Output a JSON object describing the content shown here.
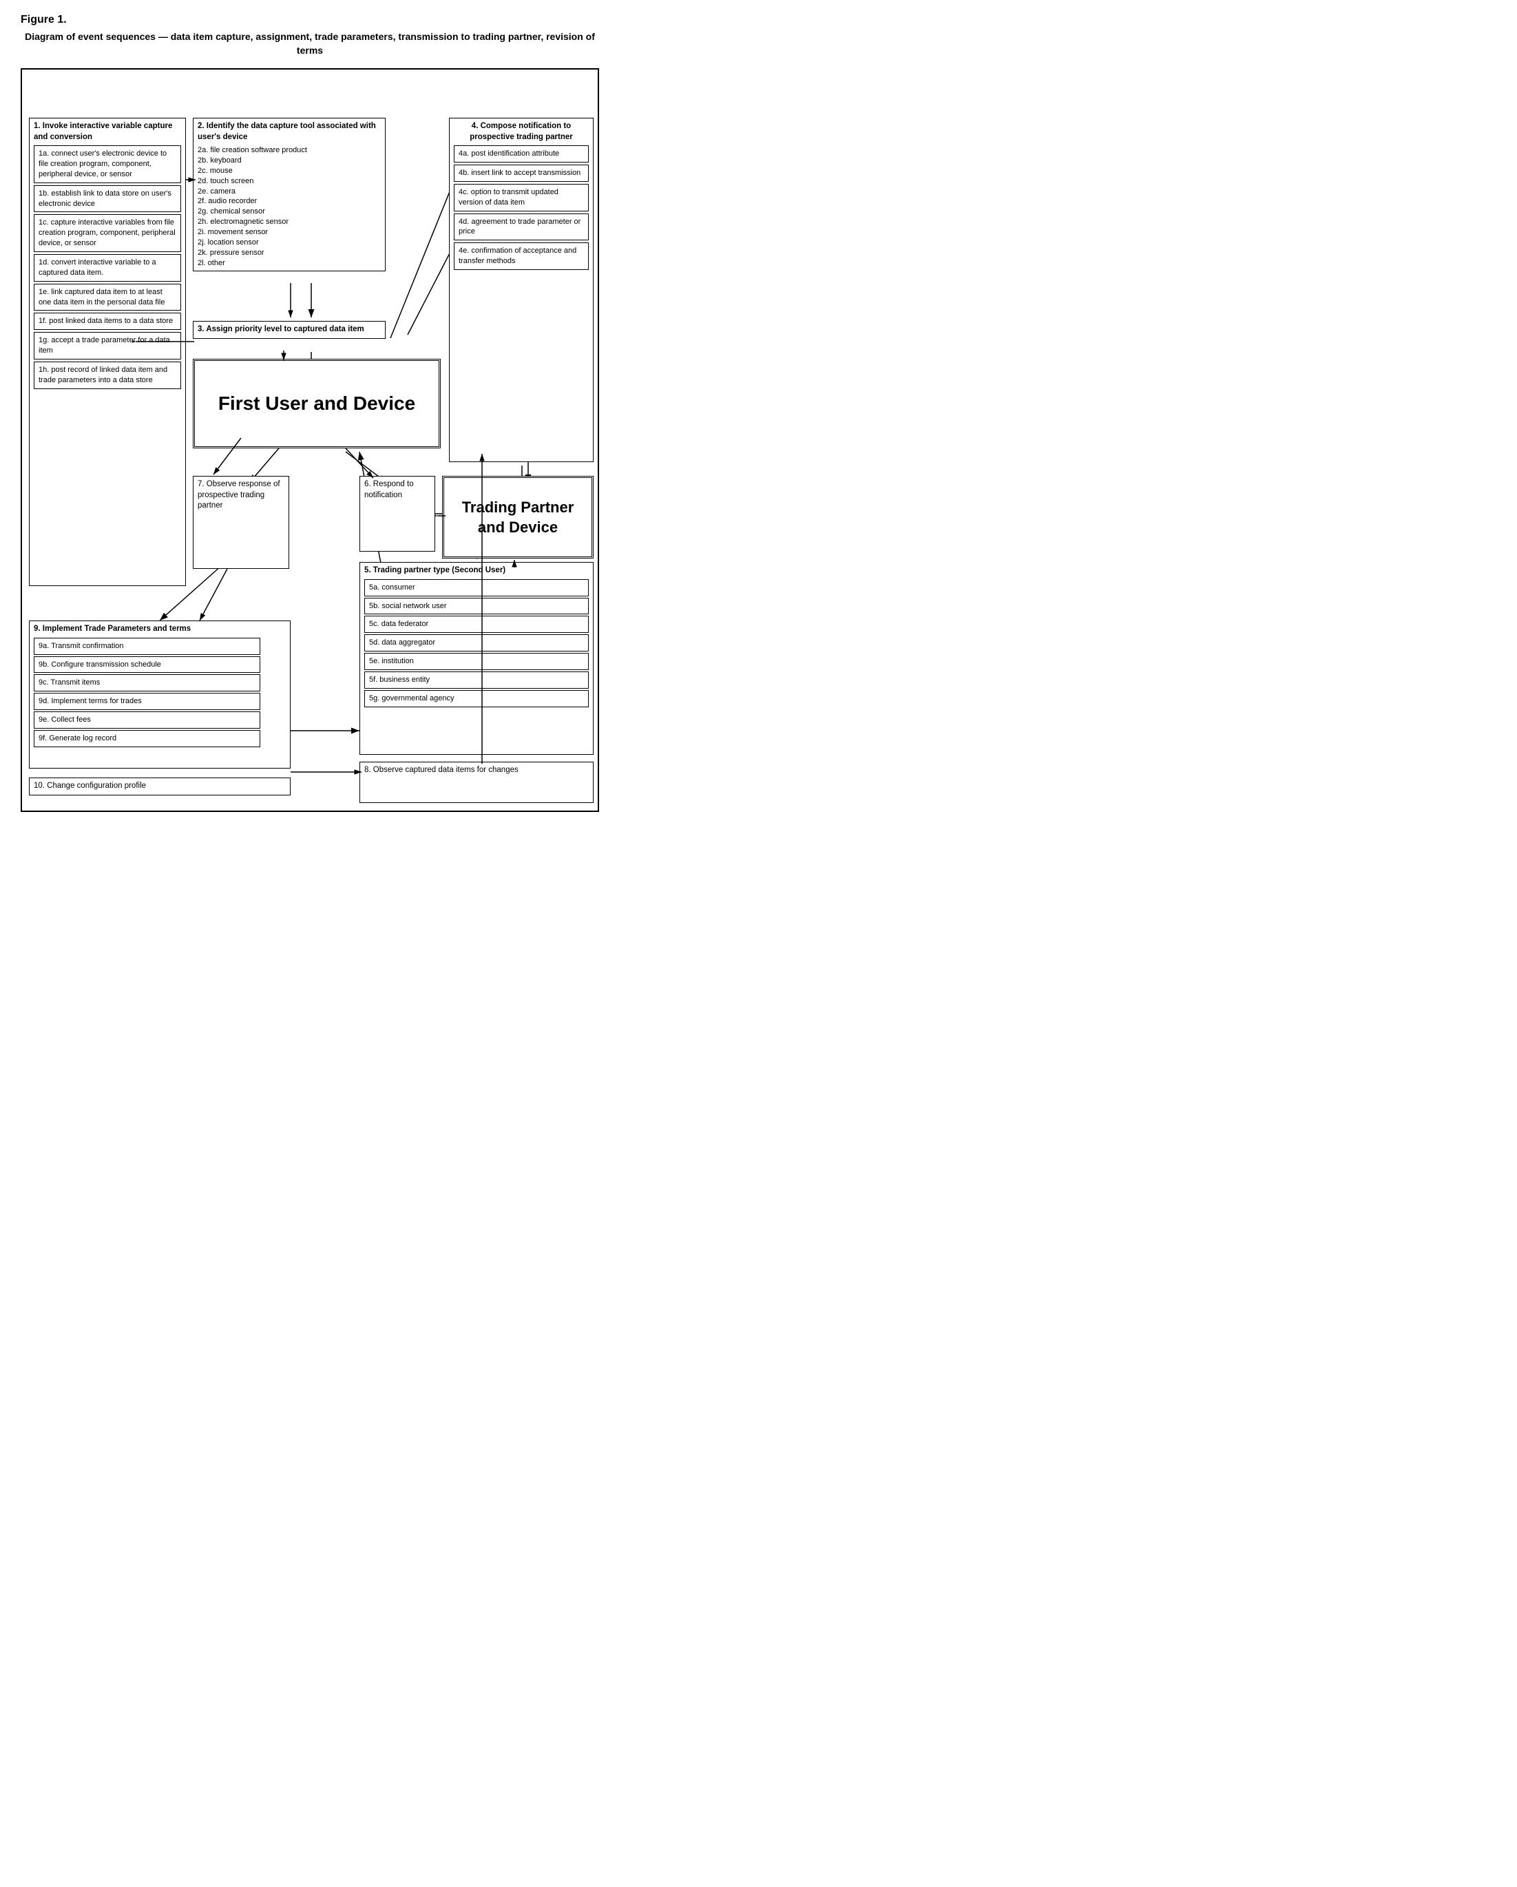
{
  "figure_label": "Figure 1.",
  "diagram_title": "Diagram of event sequences — data item capture, assignment, trade parameters, transmission to trading partner, revision of terms",
  "boxes": {
    "box1_title": "1. Invoke interactive variable capture and conversion",
    "box1a": "1a. connect user's electronic device to file creation program, component, peripheral device, or sensor",
    "box1b": "1b. establish link to data store on user's electronic device",
    "box1c": "1c. capture interactive variables from file creation program, component, peripheral device, or sensor",
    "box1d": "1d. convert interactive variable to a captured data item.",
    "box1e": "1e. link captured data item to at least one data item in the personal data file",
    "box1f": "1f. post linked data items to a data store",
    "box1g": "1g. accept a trade parameter for a data item",
    "box1h": "1h. post record of linked data item and trade parameters into a data store",
    "box2_title": "2. Identify the data capture tool associated with user's device",
    "box2_items": "2a. file creation software product\n2b. keyboard\n2c. mouse\n2d. touch screen\n2e. camera\n2f. audio recorder\n2g. chemical sensor\n2h. electromagnetic sensor\n2i. movement sensor\n2j. location sensor\n2k. pressure sensor\n2l. other",
    "box3": "3. Assign priority level to captured data item",
    "box4_title": "4. Compose notification to prospective trading partner",
    "box4a": "4a.  post identification attribute",
    "box4b": "4b. insert link to accept transmission",
    "box4c": "4c. option to transmit updated version of data item",
    "box4d": "4d. agreement to trade parameter or price",
    "box4e": "4e. confirmation of acceptance and transfer methods",
    "box_first_user": "First User and Device",
    "box_trading_partner": "Trading Partner and Device",
    "box5_title": "5. Trading partner type (Second User)",
    "box5a": "5a. consumer",
    "box5b": "5b. social network user",
    "box5c": "5c. data federator",
    "box5d": "5d. data aggregator",
    "box5e": "5e. institution",
    "box5f": "5f.  business entity",
    "box5g": "5g.  governmental agency",
    "box6": "6. Respond to notification",
    "box7": "7. Observe response of prospective trading partner",
    "box8": "8. Observe captured data items for changes",
    "box9_title": "9. Implement Trade Parameters and terms",
    "box9a": "9a. Transmit confirmation",
    "box9b": "9b. Configure transmission schedule",
    "box9c": "9c. Transmit items",
    "box9d": "9d. Implement terms for trades",
    "box9e": "9e. Collect fees",
    "box9f": "9f.   Generate log record",
    "box10": "10. Change configuration profile"
  }
}
